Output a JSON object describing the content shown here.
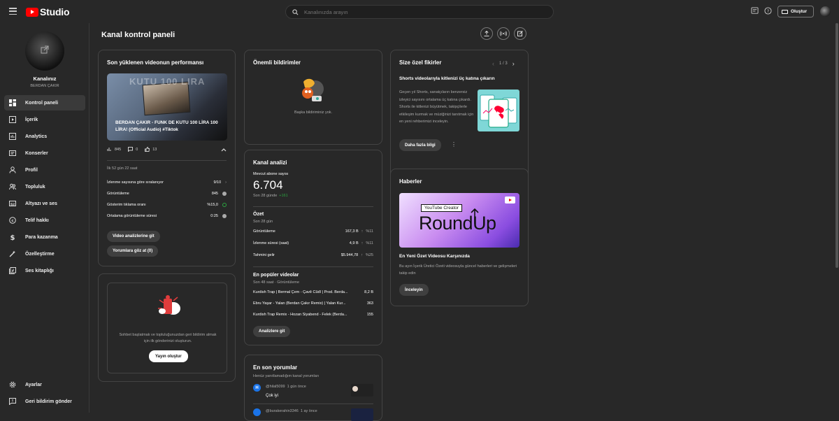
{
  "app": {
    "logo_text": "Studio",
    "search_placeholder": "Kanalınızda arayın",
    "create_label": "Oluştur"
  },
  "channel": {
    "name": "Kanalınız",
    "handle": "BERDAN ÇAKIR"
  },
  "sidebar": {
    "items": [
      {
        "label": "Kontrol paneli",
        "icon": "dashboard-icon"
      },
      {
        "label": "İçerik",
        "icon": "content-icon"
      },
      {
        "label": "Analytics",
        "icon": "analytics-icon"
      },
      {
        "label": "Konserler",
        "icon": "concerts-icon"
      },
      {
        "label": "Profil",
        "icon": "profile-icon"
      },
      {
        "label": "Topluluk",
        "icon": "community-icon"
      },
      {
        "label": "Altyazı ve ses",
        "icon": "subtitles-icon"
      },
      {
        "label": "Telif hakkı",
        "icon": "copyright-icon"
      },
      {
        "label": "Para kazanma",
        "icon": "dollar-icon"
      },
      {
        "label": "Özelleştirme",
        "icon": "customize-icon"
      },
      {
        "label": "Ses kitaplığı",
        "icon": "audio-library-icon"
      }
    ],
    "bottom": [
      {
        "label": "Ayarlar",
        "icon": "gear-icon"
      },
      {
        "label": "Geri bildirim gönder",
        "icon": "feedback-icon"
      }
    ]
  },
  "page": {
    "title": "Kanal kontrol paneli"
  },
  "latest_video": {
    "title": "Son yüklenen videonun performansı",
    "video_title": "BERDAN ÇAKIR - FUNK DE KUTU 100 LİRA 100 LİRA! (Official Audio) #Tiktok",
    "thumb_text": "KUTU 100 LIRA",
    "views": "845",
    "comments": "0",
    "likes": "13",
    "since": "İlk 52 gün 22 saat",
    "stats": [
      {
        "label": "İzlenme sayısına göre sıralanıyor",
        "value": "9/10"
      },
      {
        "label": "Görüntüleme",
        "value": "845"
      },
      {
        "label": "Gösterim tıklama oranı",
        "value": "%15,0"
      },
      {
        "label": "Ortalama görüntüleme süresi",
        "value": "0:25"
      }
    ],
    "btn_analytics": "Video analizlerine git",
    "btn_comments": "Yorumlara göz at (0)"
  },
  "community": {
    "text": "Sohbet başlatmak ve topluluğunuzdan geri bildirim almak için ilk gönderinizi oluşturun.",
    "button": "Yayın oluştur"
  },
  "notifications": {
    "title": "Önemli bildirimler",
    "empty": "Başka bildiriminiz yok."
  },
  "analytics": {
    "title": "Kanal analizi",
    "subs_label": "Mevcut abone sayısı",
    "subs_value": "6.704",
    "subs_change_label": "Son 28 günde",
    "subs_change": "+161",
    "summary_title": "Özet",
    "summary_period": "Son 28 gün",
    "summary": [
      {
        "label": "Görüntüleme",
        "value": "167,3 B",
        "change": "%11"
      },
      {
        "label": "İzlenme süresi (saat)",
        "value": "4,9 B",
        "change": "%11"
      },
      {
        "label": "Tahmini gelir",
        "value": "$5.944,78",
        "change": "%25"
      }
    ],
    "top_title": "En popüler videolar",
    "top_period": "Son 48 saat · Görüntüleme",
    "top": [
      {
        "title": "Kurdish Trap | Bermal Çem - Çavê Cûdî | Prod. Berda...",
        "views": "8,2 B"
      },
      {
        "title": "Ebru Yaşar - Yalan (Berdan Çakır Remix) | Yalan Kur...",
        "views": "363"
      },
      {
        "title": "Kurdish Trap Remix - Hozan Siyabend - Felek (Berda...",
        "views": "155"
      }
    ],
    "button": "Analizlere git"
  },
  "comments": {
    "title": "En son yorumlar",
    "subtitle": "Henüz yanıtlamadığım kanal yorumları",
    "items": [
      {
        "user": "@hilal5099",
        "time": "1 gün önce",
        "text": "Çok iyi"
      },
      {
        "user": "@burakerahin3346",
        "time": "1 ay önce",
        "text": ""
      }
    ]
  },
  "ideas": {
    "title": "Size özel fikirler",
    "pager": "1 / 3",
    "heading": "Shorts videolarıyla kitlenizi üç katına çıkarın",
    "body": "Geçen yıl Shorts, sanatçıların benzersiz izleyici sayısını ortalama üç katına çıkardı. Shorts ile kitlenizi büyütmek, takipçilerle etkileşim kurmak ve müziğinizi tanıtmak için en yeni rehberimizi inceleyin.",
    "button": "Daha fazla bilgi"
  },
  "news": {
    "title": "Haberler",
    "image_tag": "YouTube Creator",
    "image_title": "RoundUp",
    "heading": "En Yeni Özet Videosu Karşınızda",
    "body": "Bu ayın İçerik Üretici Özeti videosuyla güncel haberleri ve gelişmeleri takip edin",
    "button": "İnceleyin"
  }
}
